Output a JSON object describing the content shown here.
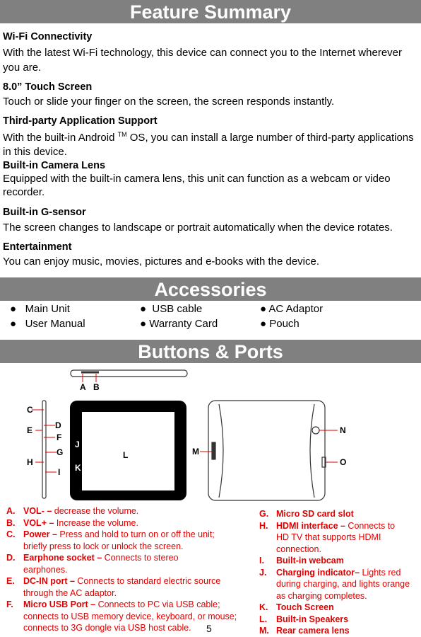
{
  "sections": {
    "feature": "Feature Summary",
    "accessories": "Accessories",
    "buttons": "Buttons & Ports"
  },
  "features": [
    {
      "title": "Wi-Fi Connectivity",
      "text": "With the latest Wi-Fi technology, this device can connect you to the Internet wherever you are."
    },
    {
      "title": "8.0” Touch Screen",
      "text": "Touch or slide your finger on the screen, the screen responds instantly."
    },
    {
      "title": "Third-party Application Support",
      "text_a": "With the built-in Android",
      "tm": "TM",
      "text_b": "OS, you can install a large number of third-party applications in this device."
    },
    {
      "title": "Built-in Camera Lens",
      "text": "Equipped with the built-in camera lens, this unit can function as a webcam or video recorder."
    },
    {
      "title": "Built-in G-sensor",
      "text": "The screen changes to landscape or portrait automatically when the device rotates."
    },
    {
      "title": "Entertainment",
      "text": "You can enjoy music, movies, pictures and e-books with the device."
    }
  ],
  "accessories": [
    "Main Unit",
    "USB cable",
    "AC Adaptor",
    "User Manual",
    "Warranty Card",
    "Pouch"
  ],
  "diagram_labels": [
    "A",
    "B",
    "C",
    "D",
    "E",
    "F",
    "G",
    "H",
    "I",
    "J",
    "K",
    "L",
    "M",
    "N",
    "O"
  ],
  "parts_left": [
    {
      "letter": "A.",
      "name": "VOL- –",
      "desc": " decrease the volume."
    },
    {
      "letter": "B.",
      "name": "VOL+ –",
      "desc": " Increase the volume."
    },
    {
      "letter": "C.",
      "name": "Power –",
      "desc": " Press and hold to turn on or off the unit; briefly press to lock or unlock the screen."
    },
    {
      "letter": "D.",
      "name": "Earphone socket –",
      "desc": " Connects to stereo earphones."
    },
    {
      "letter": "E.",
      "name": "DC-IN port –",
      "desc": " Connects to standard electric source through the AC adaptor."
    },
    {
      "letter": "F.",
      "name": "Micro USB Port –",
      "desc": " Connects to PC via USB cable; connects to USB memory device, keyboard, or mouse; connects to 3G dongle via USB host cable."
    }
  ],
  "parts_right": [
    {
      "letter": "G.",
      "name": "Micro SD card slot",
      "desc": ""
    },
    {
      "letter": "H.",
      "name": "HDMI interface –",
      "desc": " Connects to HD TV that supports HDMI connection."
    },
    {
      "letter": "I.",
      "name": "Built-in webcam",
      "desc": ""
    },
    {
      "letter": "J.",
      "name": "Charging indicator–",
      "desc": " Lights red during charging, and lights orange as charging completes."
    },
    {
      "letter": "K.",
      "name": "Touch Screen",
      "desc": ""
    },
    {
      "letter": "L.",
      "name": "Built-in Speakers",
      "desc": ""
    },
    {
      "letter": "M.",
      "name": "Rear camera lens",
      "desc": ""
    }
  ],
  "page_number": "5",
  "colors": {
    "header_bar": "#808080",
    "parts_text": "#e00000"
  }
}
